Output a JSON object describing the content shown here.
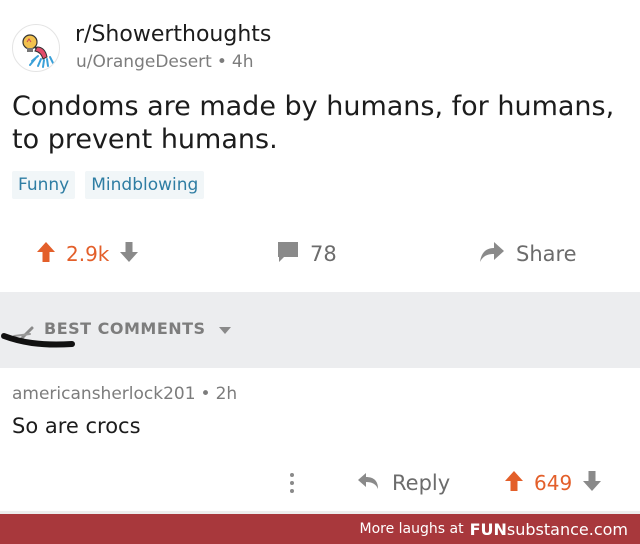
{
  "post": {
    "subreddit": "r/Showerthoughts",
    "author": "u/OrangeDesert",
    "separator": "•",
    "age": "4h",
    "subreddit_icon": "lightbulb-shower-icon",
    "title": "Condoms are made by humans, for humans, to prevent humans.",
    "flairs": [
      "Funny",
      "Mindblowing"
    ]
  },
  "post_actions": {
    "score": "2.9k",
    "comments_count": "78",
    "share_label": "Share"
  },
  "comments_section": {
    "sort_label": "BEST COMMENTS"
  },
  "comment": {
    "author": "americansherlock201",
    "separator": "•",
    "age": "2h",
    "body": "So are crocs",
    "reply_label": "Reply",
    "score": "649"
  },
  "footer": {
    "text": "More laughs at",
    "brand_part1": "FUN",
    "brand_part2": "substance.com"
  },
  "colors": {
    "upvote": "#e35f2a",
    "flair_text": "#2e7da3",
    "flair_bg": "#f1f6f8",
    "footer_bg": "#a8383c",
    "section_bg": "#ecedef"
  }
}
